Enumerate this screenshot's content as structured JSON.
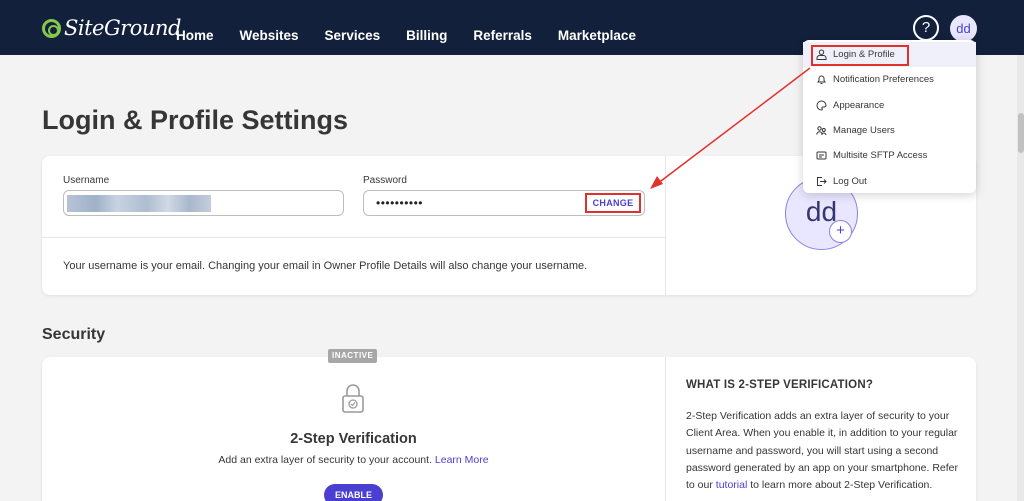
{
  "header": {
    "logo_text": "SiteGround",
    "nav": [
      "Home",
      "Websites",
      "Services",
      "Billing",
      "Referrals",
      "Marketplace"
    ],
    "help_label": "?",
    "avatar_initials": "dd"
  },
  "page": {
    "title": "Login & Profile Settings"
  },
  "account": {
    "username_label": "Username",
    "password_label": "Password",
    "password_value": "••••••••••",
    "change_label": "CHANGE",
    "note": "Your username is your email. Changing your email in Owner Profile Details will also change your username.",
    "avatar_initials": "dd",
    "avatar_add": "+"
  },
  "security": {
    "section_title": "Security",
    "status_badge": "INACTIVE",
    "tsv_title": "2-Step Verification",
    "tsv_desc": "Add an extra layer of security to your account.",
    "learn_more": "Learn More",
    "enable_label": "ENABLE",
    "info_title": "WHAT IS 2-STEP VERIFICATION?",
    "info_text_1": "2-Step Verification adds an extra layer of security to your Client Area. When you enable it, in addition to your regular username and password, you will start using a second password generated by an app on your smartphone. Refer to our ",
    "info_link": "tutorial",
    "info_text_2": " to learn more about 2-Step Verification."
  },
  "dropdown": {
    "items": [
      {
        "label": "Login & Profile",
        "icon": "user-icon"
      },
      {
        "label": "Notification Preferences",
        "icon": "bell-icon"
      },
      {
        "label": "Appearance",
        "icon": "palette-icon"
      },
      {
        "label": "Manage Users",
        "icon": "users-icon"
      },
      {
        "label": "Multisite SFTP Access",
        "icon": "server-icon"
      },
      {
        "label": "Log Out",
        "icon": "logout-icon"
      }
    ]
  },
  "colors": {
    "nav_bg": "#13203b",
    "accent": "#4a3fd0",
    "annotation": "#e0322c",
    "logo_green": "#86c84a"
  }
}
